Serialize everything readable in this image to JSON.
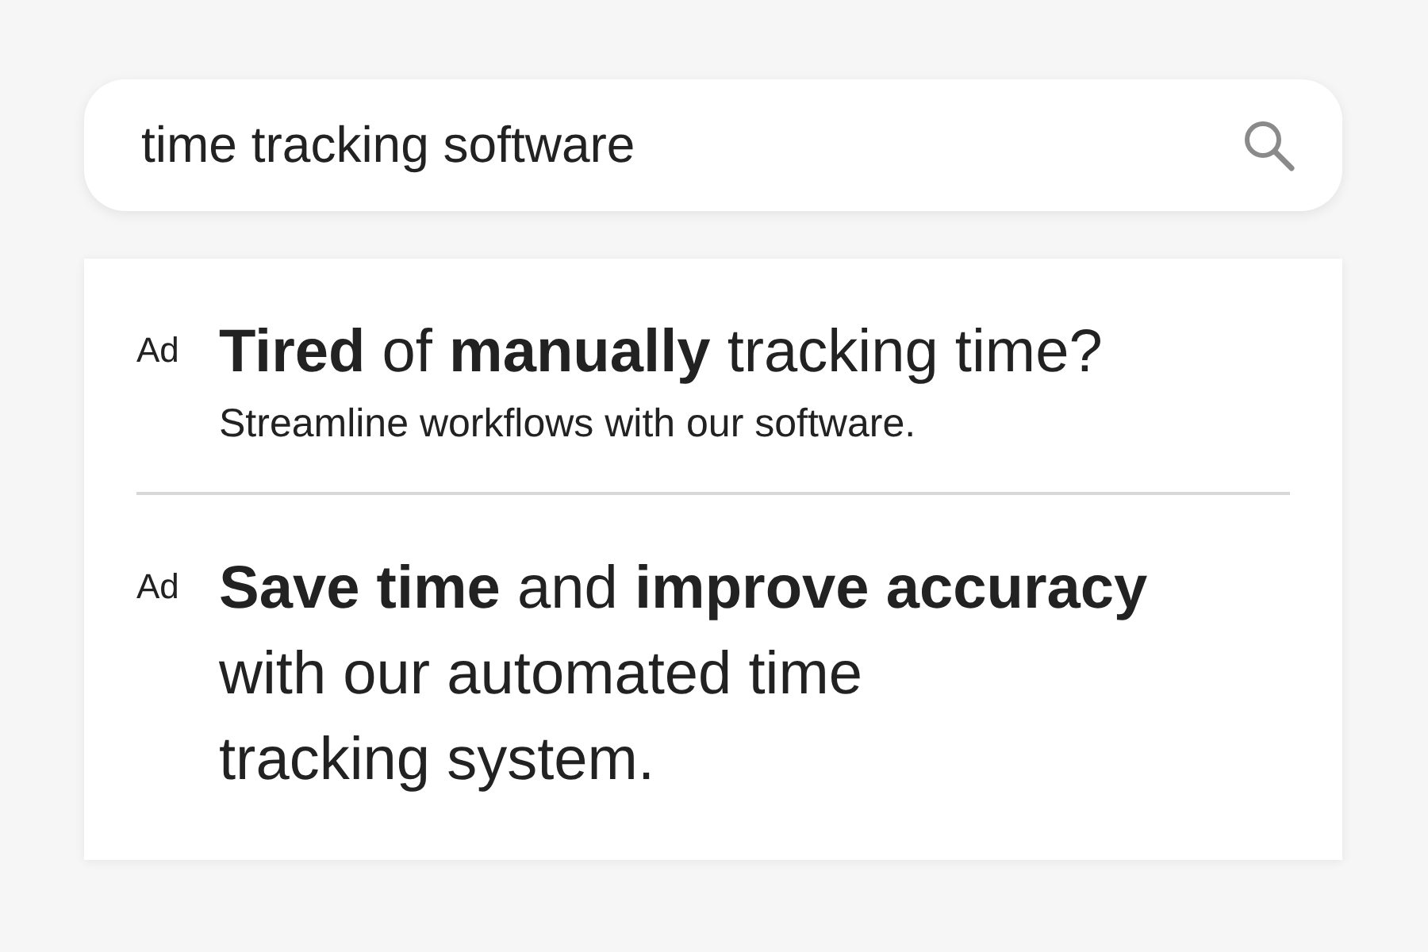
{
  "search": {
    "value": "time tracking software"
  },
  "ads": [
    {
      "label": "Ad",
      "headline_lines": [
        "**Tired** of **manually** tracking time?"
      ],
      "description": "Streamline workflows with our software."
    },
    {
      "label": "Ad",
      "headline_lines": [
        "**Save time** and **improve accuracy**",
        "with our automated time",
        "tracking system."
      ]
    }
  ]
}
